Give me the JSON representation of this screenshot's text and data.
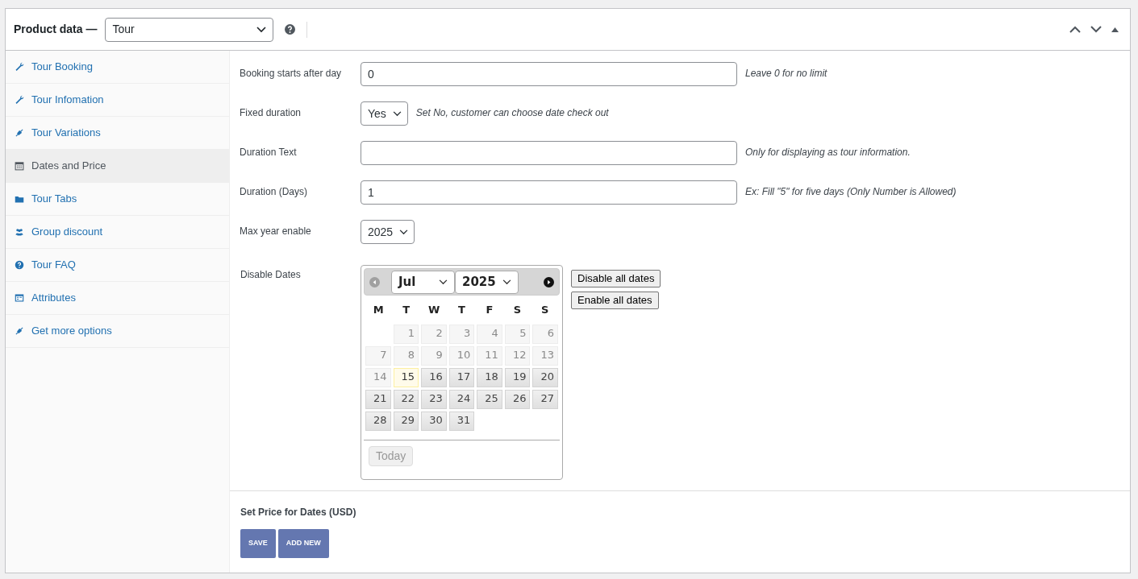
{
  "header": {
    "title": "Product data —",
    "product_type": "Tour"
  },
  "tabs": [
    {
      "label": "Tour Booking",
      "selected": false
    },
    {
      "label": "Tour Infomation",
      "selected": false
    },
    {
      "label": "Tour Variations",
      "selected": false
    },
    {
      "label": "Dates and Price",
      "selected": true
    },
    {
      "label": "Tour Tabs",
      "selected": false
    },
    {
      "label": "Group discount",
      "selected": false
    },
    {
      "label": "Tour FAQ",
      "selected": false
    },
    {
      "label": "Attributes",
      "selected": false
    },
    {
      "label": "Get more options",
      "selected": false
    }
  ],
  "fields": [
    {
      "kind": "text",
      "label": "Booking starts after day",
      "value": "0",
      "hint": "Leave 0 for no limit"
    },
    {
      "kind": "select",
      "label": "Fixed duration",
      "value": "Yes",
      "hint": "Set No, customer can choose date check out"
    },
    {
      "kind": "text",
      "label": "Duration Text",
      "hint": "Only for displaying as tour information."
    },
    {
      "kind": "text",
      "label": "Duration (Days)",
      "value": "1",
      "hint": "Ex: Fill \"5\" for five days (Only Number is Allowed)"
    },
    {
      "kind": "select",
      "label": "Max year enable",
      "value": "2025"
    }
  ],
  "disable_dates": {
    "label": "Disable Dates",
    "month": "Jul",
    "year": "2025",
    "weekdays": [
      "M",
      "T",
      "W",
      "T",
      "F",
      "S",
      "S"
    ],
    "days": [
      {
        "label": "1",
        "disabled": true,
        "today": false
      },
      {
        "label": "2",
        "disabled": true,
        "today": false
      },
      {
        "label": "3",
        "disabled": true,
        "today": false
      },
      {
        "label": "4",
        "disabled": true,
        "today": false
      },
      {
        "label": "5",
        "disabled": true,
        "today": false
      },
      {
        "label": "6",
        "disabled": true,
        "today": false
      },
      {
        "label": "7",
        "disabled": true,
        "today": false
      },
      {
        "label": "8",
        "disabled": true,
        "today": false
      },
      {
        "label": "9",
        "disabled": true,
        "today": false
      },
      {
        "label": "10",
        "disabled": true,
        "today": false
      },
      {
        "label": "11",
        "disabled": true,
        "today": false
      },
      {
        "label": "12",
        "disabled": true,
        "today": false
      },
      {
        "label": "13",
        "disabled": true,
        "today": false
      },
      {
        "label": "14",
        "disabled": true,
        "today": false
      },
      {
        "label": "15",
        "disabled": false,
        "today": true
      },
      {
        "label": "16",
        "disabled": false,
        "today": false
      },
      {
        "label": "17",
        "disabled": false,
        "today": false
      },
      {
        "label": "18",
        "disabled": false,
        "today": false
      },
      {
        "label": "19",
        "disabled": false,
        "today": false
      },
      {
        "label": "20",
        "disabled": false,
        "today": false
      },
      {
        "label": "21",
        "disabled": false,
        "today": false
      },
      {
        "label": "22",
        "disabled": false,
        "today": false
      },
      {
        "label": "23",
        "disabled": false,
        "today": false
      },
      {
        "label": "24",
        "disabled": false,
        "today": false
      },
      {
        "label": "25",
        "disabled": false,
        "today": false
      },
      {
        "label": "26",
        "disabled": false,
        "today": false
      },
      {
        "label": "27",
        "disabled": false,
        "today": false
      },
      {
        "label": "28",
        "disabled": false,
        "today": false
      },
      {
        "label": "29",
        "disabled": false,
        "today": false
      },
      {
        "label": "30",
        "disabled": false,
        "today": false
      },
      {
        "label": "31",
        "disabled": false,
        "today": false
      }
    ],
    "today_button": "Today",
    "buttons": [
      "Disable all dates",
      "Enable all dates"
    ]
  },
  "price": {
    "title": "Set Price for Dates (USD)",
    "buttons": [
      "SAVE",
      "ADD NEW"
    ]
  }
}
